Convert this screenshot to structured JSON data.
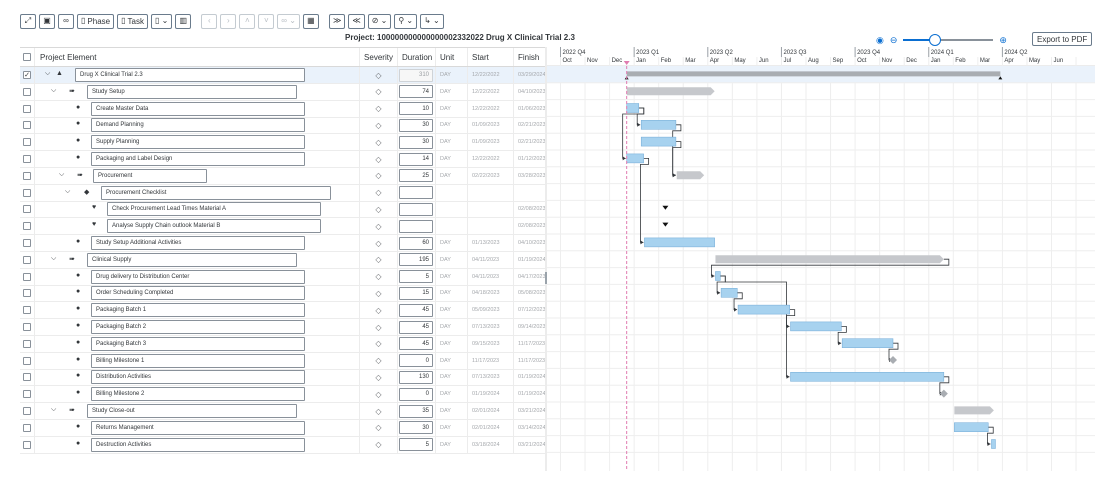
{
  "toolbar": {
    "phase_label": "Phase",
    "task_label": "Task",
    "export_label": "Export to PDF"
  },
  "project": {
    "title": "Project: 100000000000000002332022 Drug X Clinical Trial 2.3"
  },
  "zoom": {
    "level": 0.35
  },
  "table": {
    "headers": {
      "element": "Project Element",
      "severity": "Severity",
      "duration": "Duration",
      "unit": "Unit",
      "start": "Start",
      "finish": "Finish"
    },
    "rows": [
      {
        "type": "project",
        "level": 0,
        "expanded": true,
        "checked": true,
        "name": "Drug X Clinical Trial 2.3",
        "duration": "310",
        "unit": "DAY",
        "start": "12/22/2022",
        "finish": "03/29/2024",
        "readonly": true
      },
      {
        "type": "phase",
        "level": 1,
        "expanded": true,
        "name": "Study Setup",
        "duration": "74",
        "unit": "DAY",
        "start": "12/22/2022",
        "finish": "04/10/2023",
        "readonly": false
      },
      {
        "type": "task",
        "level": 2,
        "name": "Create Master Data",
        "duration": "10",
        "unit": "DAY",
        "start": "12/22/2022",
        "finish": "01/06/2023"
      },
      {
        "type": "task",
        "level": 2,
        "name": "Demand Planning",
        "duration": "30",
        "unit": "DAY",
        "start": "01/09/2023",
        "finish": "02/21/2023"
      },
      {
        "type": "task",
        "level": 2,
        "name": "Supply Planning",
        "duration": "30",
        "unit": "DAY",
        "start": "01/09/2023",
        "finish": "02/21/2023"
      },
      {
        "type": "task",
        "level": 2,
        "name": "Packaging and Label Design",
        "duration": "14",
        "unit": "DAY",
        "start": "12/22/2022",
        "finish": "01/12/2023"
      },
      {
        "type": "phase",
        "level": 2,
        "expanded": true,
        "name": "Procurement",
        "duration": "25",
        "unit": "DAY",
        "start": "02/22/2023",
        "finish": "03/28/2023",
        "readonly": false
      },
      {
        "type": "checklist",
        "level": 2,
        "expanded": true,
        "name": "Procurement Checklist",
        "duration": "",
        "unit": "",
        "start": "",
        "finish": ""
      },
      {
        "type": "checkitem",
        "level": 3,
        "name": "Check Procurement Lead Times Material A",
        "duration": "",
        "unit": "",
        "start": "",
        "finish": "02/08/2023"
      },
      {
        "type": "checkitem",
        "level": 3,
        "name": "Analyse Supply Chain outlook Material B",
        "duration": "",
        "unit": "",
        "start": "",
        "finish": "02/08/2023"
      },
      {
        "type": "task",
        "level": 2,
        "name": "Study Setup Additional Activities",
        "duration": "60",
        "unit": "DAY",
        "start": "01/13/2023",
        "finish": "04/10/2023"
      },
      {
        "type": "phase",
        "level": 1,
        "expanded": true,
        "name": "Clinical Supply",
        "duration": "195",
        "unit": "DAY",
        "start": "04/11/2023",
        "finish": "01/19/2024",
        "readonly": false
      },
      {
        "type": "task",
        "level": 2,
        "name": "Drug delivery to Distribution Center",
        "duration": "5",
        "unit": "DAY",
        "start": "04/11/2023",
        "finish": "04/17/2023"
      },
      {
        "type": "task",
        "level": 2,
        "name": "Order Scheduling Completed",
        "duration": "15",
        "unit": "DAY",
        "start": "04/18/2023",
        "finish": "05/08/2023"
      },
      {
        "type": "task",
        "level": 2,
        "name": "Packaging Batch 1",
        "duration": "45",
        "unit": "DAY",
        "start": "05/09/2023",
        "finish": "07/12/2023"
      },
      {
        "type": "task",
        "level": 2,
        "name": "Packaging Batch 2",
        "duration": "45",
        "unit": "DAY",
        "start": "07/13/2023",
        "finish": "09/14/2023"
      },
      {
        "type": "task",
        "level": 2,
        "name": "Packaging Batch 3",
        "duration": "45",
        "unit": "DAY",
        "start": "09/15/2023",
        "finish": "11/17/2023"
      },
      {
        "type": "task",
        "level": 2,
        "name": "Billing Milestone 1",
        "duration": "0",
        "unit": "DAY",
        "start": "11/17/2023",
        "finish": "11/17/2023"
      },
      {
        "type": "task",
        "level": 2,
        "name": "Distribution Activities",
        "duration": "130",
        "unit": "DAY",
        "start": "07/13/2023",
        "finish": "01/19/2024"
      },
      {
        "type": "task",
        "level": 2,
        "name": "Billing Milestone 2",
        "duration": "0",
        "unit": "DAY",
        "start": "01/19/2024",
        "finish": "01/19/2024"
      },
      {
        "type": "phase",
        "level": 1,
        "expanded": true,
        "name": "Study Close-out",
        "duration": "35",
        "unit": "DAY",
        "start": "02/01/2024",
        "finish": "03/21/2024",
        "readonly": false
      },
      {
        "type": "task",
        "level": 2,
        "name": "Returns Management",
        "duration": "30",
        "unit": "DAY",
        "start": "02/01/2024",
        "finish": "03/14/2024"
      },
      {
        "type": "task",
        "level": 2,
        "name": "Destruction Activities",
        "duration": "5",
        "unit": "DAY",
        "start": "03/18/2024",
        "finish": "03/21/2024"
      }
    ]
  },
  "gantt": {
    "quarters": [
      "2022 Q4",
      "2023 Q1",
      "2023 Q2",
      "2023 Q3",
      "2023 Q4",
      "2024 Q1",
      "2024 Q2"
    ],
    "months": [
      "Oct",
      "Nov",
      "Dec",
      "Jan",
      "Feb",
      "Mar",
      "Apr",
      "May",
      "Jun",
      "Jul",
      "Aug",
      "Sep",
      "Oct",
      "Nov",
      "Dec",
      "Jan",
      "Feb",
      "Mar",
      "Apr",
      "May",
      "Jun"
    ],
    "colors": {
      "phase": "#c6c8cc",
      "task": "#a7d2ef",
      "task_border": "#6fa9d6",
      "today": "#e07bb0",
      "link": "#32363a"
    }
  }
}
